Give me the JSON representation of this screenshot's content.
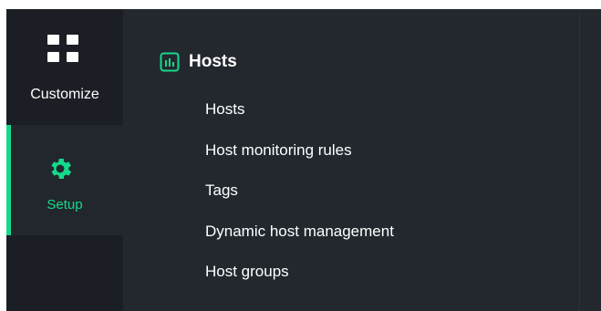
{
  "sidebar": {
    "items": [
      {
        "label": "Customize",
        "icon": "grid-icon",
        "active": false
      },
      {
        "label": "Setup",
        "icon": "gear-icon",
        "active": true
      }
    ],
    "accent_color": "#14d98b"
  },
  "menu": {
    "section_icon": "hosts-icon",
    "section_title": "Hosts",
    "items": [
      {
        "label": "Hosts"
      },
      {
        "label": "Host monitoring rules"
      },
      {
        "label": "Tags"
      },
      {
        "label": "Dynamic host management"
      },
      {
        "label": "Host groups"
      }
    ]
  },
  "colors": {
    "background": "#23282f",
    "sidebar": "#1b1f25",
    "text": "#ffffff",
    "accent": "#14d98b"
  }
}
